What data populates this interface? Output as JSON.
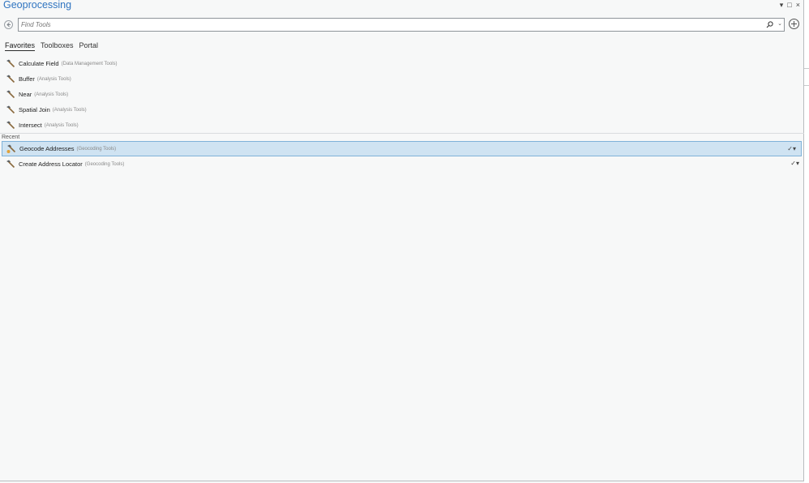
{
  "window": {
    "title": "Geoprocessing",
    "controls": {
      "menu": "▾",
      "restore": "□",
      "close": "×"
    }
  },
  "search": {
    "placeholder": "Find Tools",
    "value": ""
  },
  "tabs": [
    {
      "label": "Favorites",
      "active": true
    },
    {
      "label": "Toolboxes",
      "active": false
    },
    {
      "label": "Portal",
      "active": false
    }
  ],
  "favorites": [
    {
      "name": "Calculate Field",
      "toolbox": "(Data Management Tools)"
    },
    {
      "name": "Buffer",
      "toolbox": "(Analysis Tools)"
    },
    {
      "name": "Near",
      "toolbox": "(Analysis Tools)"
    },
    {
      "name": "Spatial Join",
      "toolbox": "(Analysis Tools)"
    },
    {
      "name": "Intersect",
      "toolbox": "(Analysis Tools)"
    }
  ],
  "recent_label": "Recent",
  "recent": [
    {
      "name": "Geocode Addresses",
      "toolbox": "(Geocoding Tools)",
      "selected": true,
      "status": "✓▾"
    },
    {
      "name": "Create Address Locator",
      "toolbox": "(Geocoding Tools)",
      "selected": false,
      "status": "✓▾"
    }
  ],
  "icons": {
    "tool": "hammer-icon",
    "search": "search-icon",
    "back": "back-arrow-icon",
    "add": "add-icon"
  },
  "colors": {
    "title": "#2f74c0",
    "selection": "#cfe3f2",
    "selection_border": "#7fb2d9"
  }
}
